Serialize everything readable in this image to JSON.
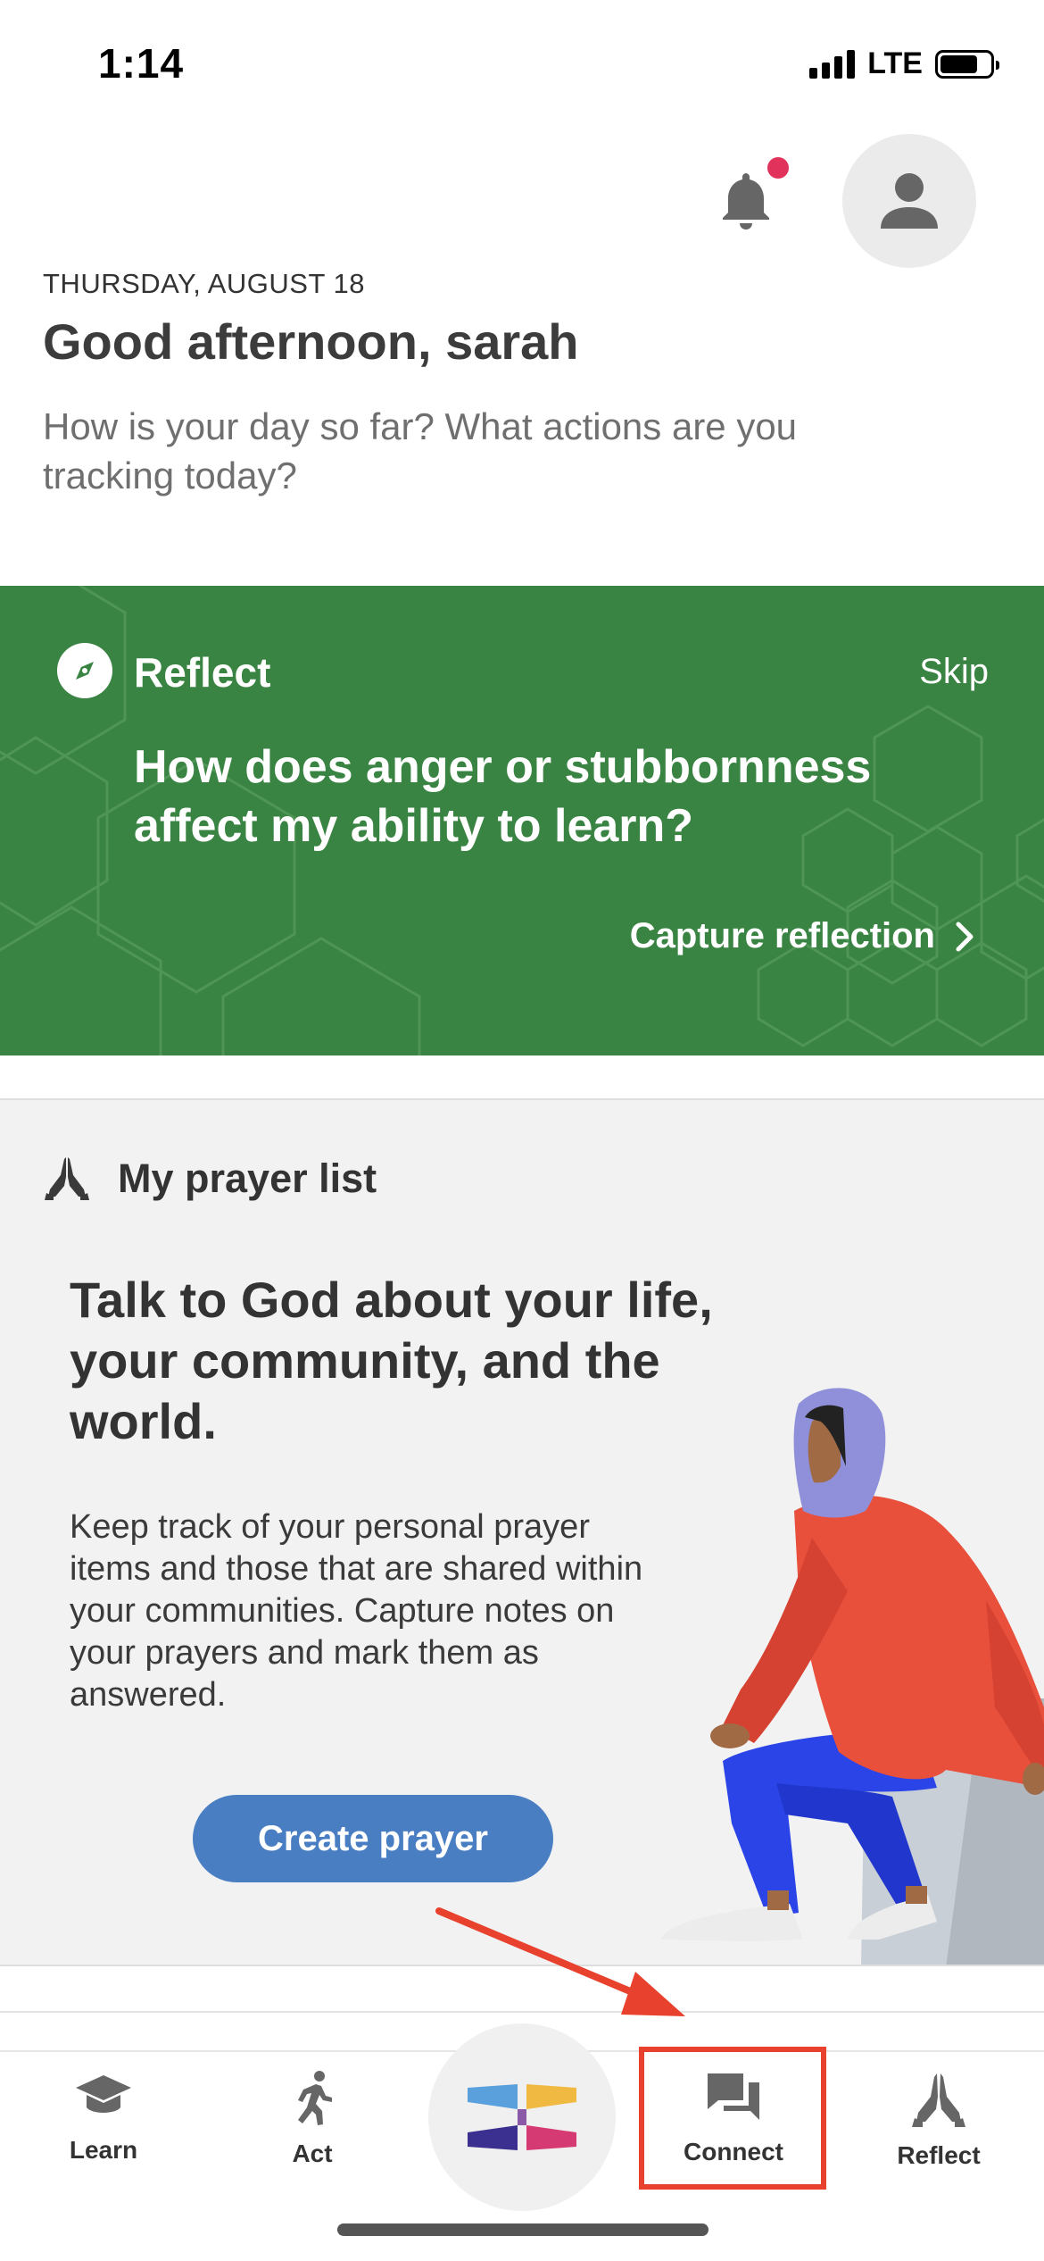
{
  "status_bar": {
    "time": "1:14",
    "network": "LTE"
  },
  "header": {
    "date": "THURSDAY, AUGUST 18",
    "greeting": "Good afternoon, sarah",
    "subtext": "How is your day so far? What actions are you tracking today?",
    "notification_dot_color": "#e0325a"
  },
  "reflect_card": {
    "title": "Reflect",
    "skip_label": "Skip",
    "question": "How does anger or stubbornness affect my ability to learn?",
    "capture_label": "Capture reflection",
    "background_color": "#3a8443"
  },
  "prayer_list": {
    "header": "My prayer list",
    "headline": "Talk to God about your life, your community, and the world.",
    "description": "Keep track of your personal prayer items and those that are shared within your communities. Capture notes on your prayers and mark them as answered.",
    "button_label": "Create prayer",
    "button_color": "#4a7ec3"
  },
  "tab_bar": {
    "tabs": [
      {
        "label": "Learn",
        "icon": "graduation-cap-icon"
      },
      {
        "label": "Act",
        "icon": "running-person-icon"
      },
      {
        "label": "Connect",
        "icon": "chat-bubbles-icon"
      },
      {
        "label": "Reflect",
        "icon": "praying-hands-icon"
      }
    ],
    "center_icon": "app-logo-icon",
    "highlight_color": "#e8412d"
  }
}
